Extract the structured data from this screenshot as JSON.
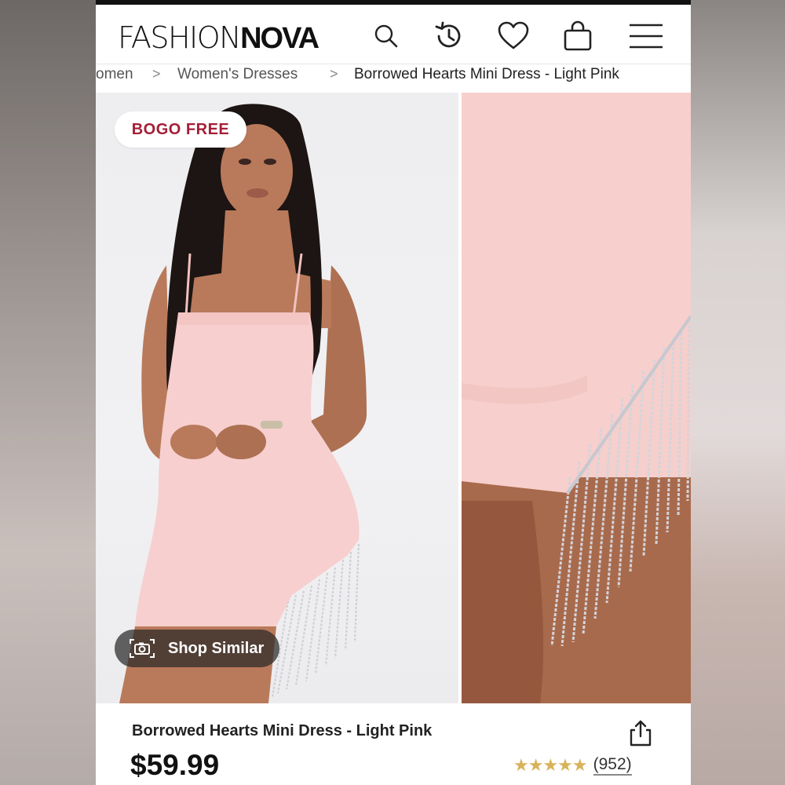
{
  "header": {
    "logo_light": "FASHION",
    "logo_bold": "NOVA",
    "icons": [
      "search-icon",
      "history-icon",
      "heart-icon",
      "bag-icon",
      "menu-icon"
    ]
  },
  "breadcrumb": {
    "items": [
      "omen",
      "Women's Dresses",
      "Borrowed Hearts Mini Dress - Light Pink"
    ],
    "separator": ">"
  },
  "gallery": {
    "badge": "BOGO FREE",
    "shop_similar_label": "Shop Similar"
  },
  "product": {
    "title": "Borrowed Hearts Mini Dress - Light Pink",
    "price": "$59.99",
    "stars_display": "★★★★★",
    "rating": 4.5,
    "review_count": "(952)"
  },
  "colors": {
    "badge_text": "#a51e36",
    "star": "#d9b25a",
    "dress_pink": "#f7cfcf"
  }
}
